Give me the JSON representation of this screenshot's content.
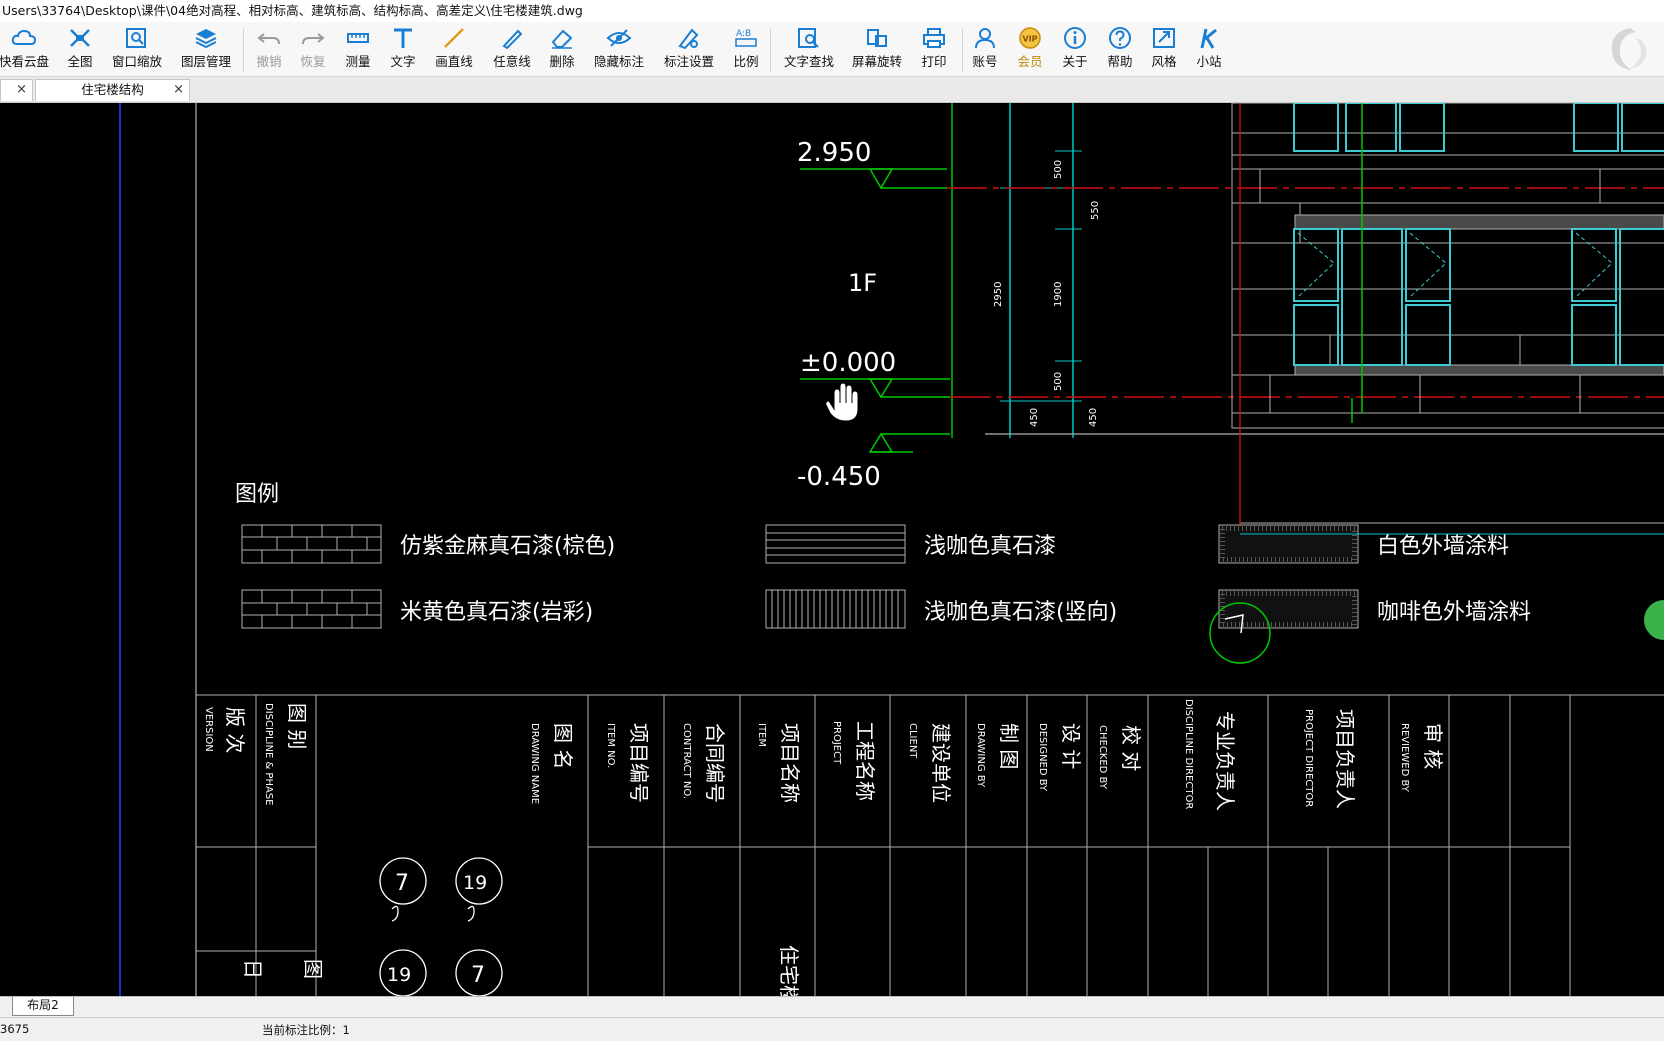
{
  "window": {
    "title": "Users\\33764\\Desktop\\课件\\04绝对高程、相对标高、建筑标高、结构标高、高差定义\\住宅楼建筑.dwg"
  },
  "toolbar": {
    "items": [
      {
        "label": "快看云盘",
        "icon": "cloud-icon"
      },
      {
        "label": "全图",
        "icon": "fullview-icon"
      },
      {
        "label": "窗口缩放",
        "icon": "window-zoom-icon"
      },
      {
        "label": "图层管理",
        "icon": "layers-icon"
      },
      {
        "label": "撤销",
        "icon": "undo-icon"
      },
      {
        "label": "恢复",
        "icon": "redo-icon"
      },
      {
        "label": "测量",
        "icon": "measure-icon"
      },
      {
        "label": "文字",
        "icon": "text-icon"
      },
      {
        "label": "画直线",
        "icon": "line-icon"
      },
      {
        "label": "任意线",
        "icon": "freehand-icon"
      },
      {
        "label": "删除",
        "icon": "eraser-icon"
      },
      {
        "label": "隐藏标注",
        "icon": "hide-icon"
      },
      {
        "label": "标注设置",
        "icon": "annotation-settings-icon"
      },
      {
        "label": "比例",
        "icon": "scale-icon"
      },
      {
        "label": "文字查找",
        "icon": "text-search-icon"
      },
      {
        "label": "屏幕旋转",
        "icon": "rotate-icon"
      },
      {
        "label": "打印",
        "icon": "print-icon"
      },
      {
        "label": "账号",
        "icon": "account-icon"
      },
      {
        "label": "会员",
        "icon": "vip-icon"
      },
      {
        "label": "关于",
        "icon": "info-icon"
      },
      {
        "label": "帮助",
        "icon": "help-icon"
      },
      {
        "label": "风格",
        "icon": "style-icon"
      },
      {
        "label": "小站",
        "icon": "site-icon"
      }
    ],
    "vip_badge": "VIP",
    "colors": {
      "icon_blue": "#1a7fd4",
      "disabled": "#9a9a9a",
      "vip": "#d9a21b"
    }
  },
  "tabs": {
    "first_close": "×",
    "doc_title": "住宅楼结构",
    "doc_close": "×"
  },
  "drawing": {
    "elevations": {
      "top": "2.950",
      "zero": "±0.000",
      "bottom": "-0.450"
    },
    "floor_label": "1F",
    "dims": {
      "d1": "500",
      "d2": "550",
      "d3": "2950",
      "d4": "1900",
      "d5": "500",
      "d6": "450",
      "d7": "450"
    },
    "legend_title": "图例",
    "legend": [
      {
        "label": "仿紫金麻真石漆(棕色)",
        "pattern": "brick"
      },
      {
        "label": "浅咖色真石漆",
        "pattern": "horizontal"
      },
      {
        "label": "白色外墙涂料",
        "pattern": "dots"
      },
      {
        "label": "米黄色真石漆(岩彩)",
        "pattern": "brick"
      },
      {
        "label": "浅咖色真石漆(竖向)",
        "pattern": "vertical"
      },
      {
        "label": "咖啡色外墙涂料",
        "pattern": "dots"
      }
    ],
    "title_block": {
      "c1_cn": "版 次",
      "c1_en": "VERSION",
      "c2_cn": "图 别",
      "c2_en": "DISCIPLINE & PHASE",
      "c3_cn": "图 名",
      "c3_en": "DRAWING NAME",
      "c4_cn": "项目编号",
      "c4_en": "ITEM NO.",
      "c5_cn": "合同编号",
      "c5_en": "CONTRACT NO.",
      "c6_cn": "项目名称",
      "c6_en": "ITEM",
      "c7_cn": "工程名称",
      "c7_en": "PROJECT",
      "c8_cn": "建设单位",
      "c8_en": "CLIENT",
      "c9_cn": "制 图",
      "c9_en": "DRAWING BY",
      "c10_cn": "设 计",
      "c10_en": "DESIGNED BY",
      "c11_cn": "校 对",
      "c11_en": "CHECKED BY",
      "c12_cn": "专业负责人",
      "c12_en": "DISCIPLINE DIRECTOR",
      "c13_cn": "项目负责人",
      "c13_en": "PROJECT DIRECTOR",
      "c14_cn": "审 核",
      "c14_en": "REVIEWED BY",
      "row_date": "日",
      "row_tu": "图",
      "item_value": "住宅楼",
      "circle_a": "7",
      "circle_b": "19"
    }
  },
  "layout_tabs": {
    "active": "布局2"
  },
  "status": {
    "coord": "3675",
    "scale_label": "当前标注比例：1"
  },
  "colors": {
    "background": "#000000",
    "green": "#00c800",
    "red": "#d01010",
    "cyan": "#00c8c8",
    "gray_line": "#b0b0b0",
    "window_frame": "#3ccad3"
  }
}
